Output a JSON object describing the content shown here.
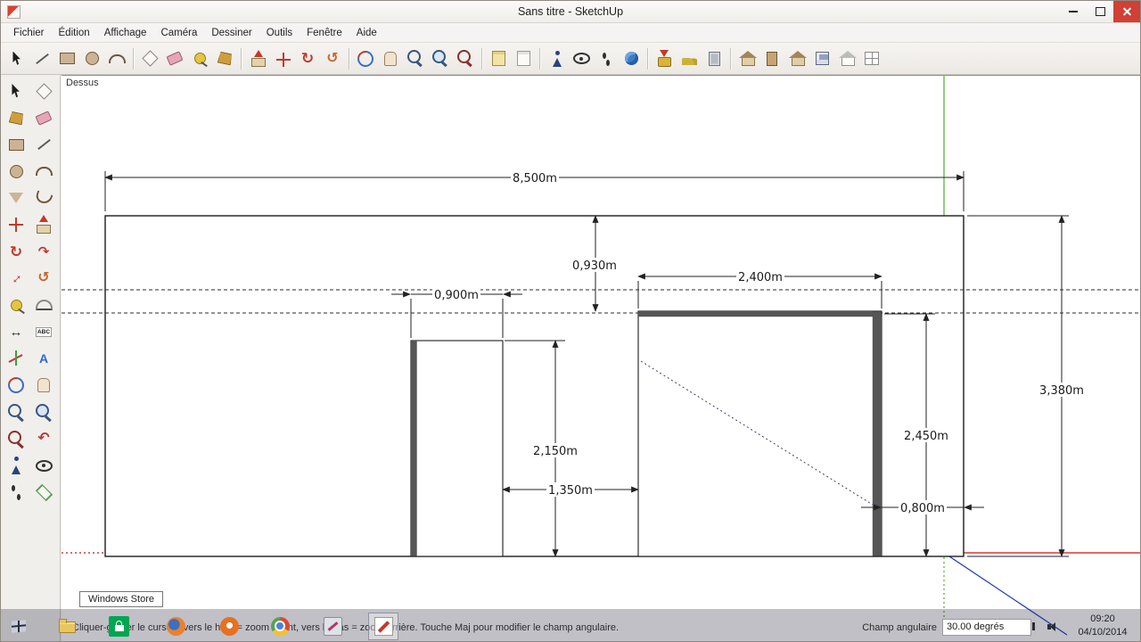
{
  "window": {
    "title": "Sans titre - SketchUp"
  },
  "menu_bar": {
    "items": [
      "Fichier",
      "Édition",
      "Affichage",
      "Caméra",
      "Dessiner",
      "Outils",
      "Fenêtre",
      "Aide"
    ]
  },
  "canvas": {
    "view_label": "Dessus"
  },
  "dimensions": {
    "total_width": "8,500m",
    "header_height": "0,930m",
    "garage_width": "2,400m",
    "door_width": "0,900m",
    "wall_height": "3,380m",
    "door_height": "2,150m",
    "pier_width": "1,350m",
    "garage_height": "2,450m",
    "right_pier_width": "0,800m"
  },
  "status_bar": {
    "help_text": "Cliquer-glisser le curseur vers le haut = zoom avant, vers le bas = zoom arrière. Touche Maj pour modifier le champ angulaire.",
    "field_label": "Champ angulaire",
    "field_value": "30.00 degrés"
  },
  "taskbar": {
    "tooltip": "Windows Store",
    "time": "09:20",
    "date": "04/10/2014",
    "items": [
      "start",
      "file-explorer",
      "windows-store",
      "firefox",
      "browser-orange",
      "chrome",
      "paint-app",
      "sketchup-active"
    ],
    "tray": [
      "show-hidden-icons",
      "battery",
      "network",
      "volume"
    ]
  },
  "colors": {
    "axis_green": "#4caf30",
    "axis_red": "#cc1111",
    "axis_blue": "#1a35c8",
    "store_green": "#00a651",
    "close_red": "#d23f34"
  },
  "top_toolbar": {
    "tools": [
      "select",
      "line",
      "rectangle",
      "circle",
      "arc",
      "make-component",
      "eraser",
      "tape-measure",
      "paint-bucket",
      "push-pull",
      "move",
      "rotate",
      "offset",
      "orbit",
      "pan",
      "zoom",
      "zoom-window",
      "zoom-extents",
      "previous-view",
      "next-view",
      "position-camera",
      "look-around",
      "walk",
      "google-earth",
      "get-current-view",
      "toggle-terrain",
      "photo-textures",
      "get-models",
      "component-door",
      "share-model",
      "save",
      "house-template",
      "component-window"
    ]
  },
  "left_toolbar": {
    "tools": [
      "select",
      "make-component",
      "paint-bucket",
      "eraser",
      "rectangle",
      "line",
      "circle",
      "arc",
      "polygon",
      "freehand",
      "move",
      "push-pull",
      "rotate",
      "follow-me",
      "scale",
      "offset",
      "tape-measure",
      "protractor",
      "dimension",
      "text",
      "axes",
      "3d-text",
      "orbit",
      "pan",
      "zoom",
      "zoom-window",
      "zoom-extents",
      "zoom-previous",
      "position-camera",
      "look-around",
      "walk",
      "section-plane"
    ]
  }
}
